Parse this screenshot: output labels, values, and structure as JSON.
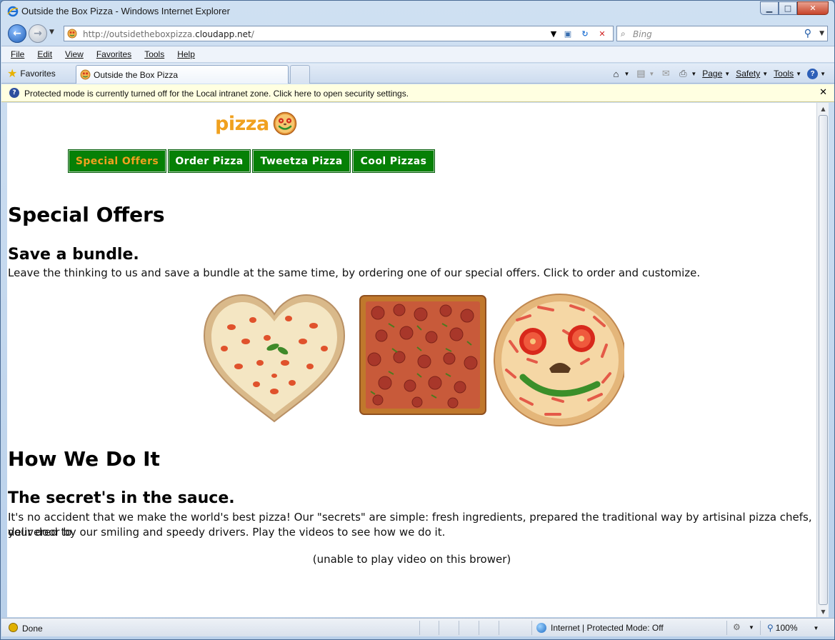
{
  "window": {
    "title": "Outside the Box Pizza - Windows Internet Explorer",
    "buttons": {
      "minimize": "▁",
      "maximize": "□",
      "close": "✕"
    }
  },
  "address_bar": {
    "url_prefix": "http://outsidetheboxpizza.",
    "url_host": "cloudapp.net",
    "url_suffix": "/",
    "search_placeholder": "Bing"
  },
  "menu": {
    "items": [
      {
        "label": "File"
      },
      {
        "label": "Edit"
      },
      {
        "label": "View"
      },
      {
        "label": "Favorites"
      },
      {
        "label": "Tools"
      },
      {
        "label": "Help"
      }
    ]
  },
  "favorites_bar": {
    "favorites_label": "Favorites",
    "tab_label": "Outside the Box Pizza",
    "commands": [
      {
        "label": "Page"
      },
      {
        "label": "Safety"
      },
      {
        "label": "Tools"
      }
    ]
  },
  "infobar": {
    "text": "Protected mode is currently turned off for the Local intranet zone.  Click here to open security settings.",
    "close": "✕"
  },
  "page": {
    "logo_text": "pizza",
    "nav": [
      {
        "label": "Special Offers",
        "active": true
      },
      {
        "label": "Order Pizza",
        "active": false
      },
      {
        "label": "Tweetza Pizza",
        "active": false
      },
      {
        "label": "Cool Pizzas",
        "active": false
      }
    ],
    "section1": {
      "heading": "Special Offers",
      "subheading": "Save a bundle.",
      "body": "Leave the thinking to us and save a bundle at the same time, by ordering one of our special offers. Click to order and customize."
    },
    "section2": {
      "heading": "How We Do It",
      "subheading": "The secret's in the sauce.",
      "body_line1": "It's no accident that we make the world's best pizza! Our \"secrets\" are simple: fresh ingredients, prepared the traditional way by artisinal pizza chefs, delivered to",
      "body_line2": "your door by our smiling and speedy drivers. Play the videos to see how we do it.",
      "video_note": "(unable to play video on this brower)"
    }
  },
  "status_bar": {
    "status": "Done",
    "zone": "Internet | Protected Mode: Off",
    "zoom": "100%"
  },
  "colors": {
    "nav_green": "#068006",
    "accent_orange": "#f0a11f"
  }
}
